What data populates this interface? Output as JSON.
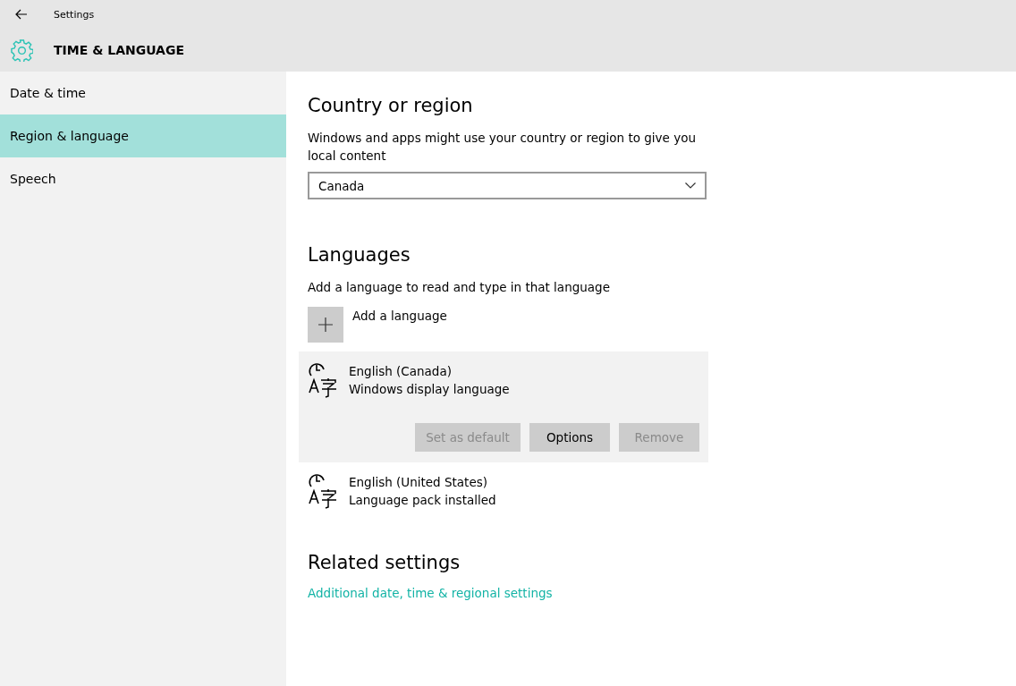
{
  "window": {
    "title": "Settings"
  },
  "header": {
    "title": "TIME & LANGUAGE"
  },
  "sidebar": {
    "items": [
      {
        "label": "Date & time",
        "selected": false
      },
      {
        "label": "Region & language",
        "selected": true
      },
      {
        "label": "Speech",
        "selected": false
      }
    ]
  },
  "country": {
    "heading": "Country or region",
    "description": "Windows and apps might use your country or region to give you local content",
    "value": "Canada"
  },
  "languages": {
    "heading": "Languages",
    "description": "Add a language to read and type in that language",
    "add_label": "Add a language",
    "items": [
      {
        "name": "English (Canada)",
        "status": "Windows display language",
        "expanded": true,
        "buttons": [
          {
            "label": "Set as default",
            "disabled": true
          },
          {
            "label": "Options",
            "disabled": false
          },
          {
            "label": "Remove",
            "disabled": true
          }
        ]
      },
      {
        "name": "English (United States)",
        "status": "Language pack installed",
        "expanded": false
      }
    ]
  },
  "related": {
    "heading": "Related settings",
    "link": "Additional date, time & regional settings"
  }
}
